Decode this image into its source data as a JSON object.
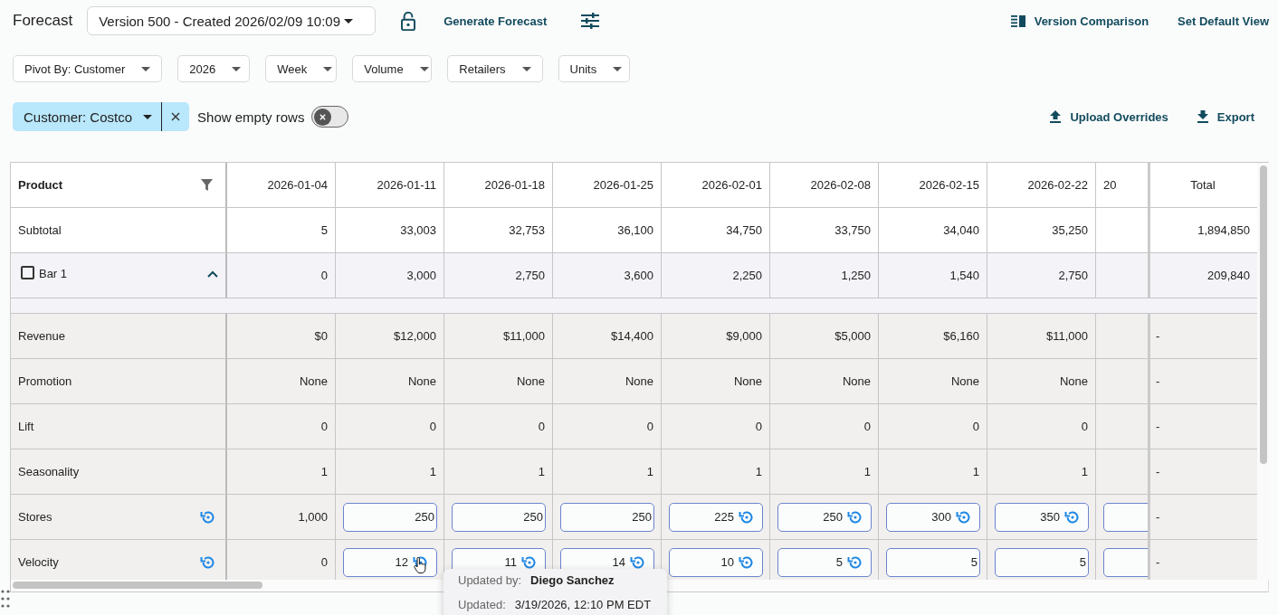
{
  "header": {
    "title": "Forecast",
    "version": "Version 500 - Created 2026/02/09 10:09",
    "generate": "Generate Forecast",
    "version_comparison": "Version Comparison",
    "set_default": "Set Default View"
  },
  "filters": [
    "Pivot By: Customer",
    "2026",
    "Week",
    "Volume",
    "Retailers",
    "Units"
  ],
  "chip": {
    "label": "Customer: Costco"
  },
  "toggle": {
    "label": "Show empty rows",
    "on": false
  },
  "actions": {
    "upload": "Upload Overrides",
    "export": "Export"
  },
  "table": {
    "first_column": "Product",
    "columns": [
      "2026-01-04",
      "2026-01-11",
      "2026-01-18",
      "2026-01-25",
      "2026-02-01",
      "2026-02-08",
      "2026-02-15",
      "2026-02-22",
      "20"
    ],
    "total_column": "Total",
    "rows": [
      {
        "kind": "subtotal",
        "label": "Subtotal",
        "cells": [
          "5",
          "33,003",
          "32,753",
          "36,100",
          "34,750",
          "33,750",
          "34,040",
          "35,250",
          null
        ],
        "total": "1,894,850"
      },
      {
        "kind": "group",
        "label": "Bar 1",
        "checked": false,
        "expanded": true,
        "cells": [
          "0",
          "3,000",
          "2,750",
          "3,600",
          "2,250",
          "1,250",
          "1,540",
          "2,750",
          null
        ],
        "total": "209,840"
      },
      {
        "kind": "metric",
        "label": "Revenue",
        "reset": false,
        "cells": [
          "$0",
          "$12,000",
          "$11,000",
          "$14,400",
          "$9,000",
          "$5,000",
          "$6,160",
          "$11,000",
          null
        ],
        "total": "-"
      },
      {
        "kind": "metric",
        "label": "Promotion",
        "reset": false,
        "cells": [
          "None",
          "None",
          "None",
          "None",
          "None",
          "None",
          "None",
          "None",
          null
        ],
        "total": "-"
      },
      {
        "kind": "metric",
        "label": "Lift",
        "reset": false,
        "cells": [
          "0",
          "0",
          "0",
          "0",
          "0",
          "0",
          "0",
          "0",
          null
        ],
        "total": "-"
      },
      {
        "kind": "metric",
        "label": "Seasonality",
        "reset": false,
        "cells": [
          "1",
          "1",
          "1",
          "1",
          "1",
          "1",
          "1",
          "1",
          null
        ],
        "total": "-"
      },
      {
        "kind": "metric",
        "label": "Stores",
        "reset": true,
        "cells": [
          "1,000",
          {
            "kind": "input",
            "value": "250",
            "reset": false
          },
          {
            "kind": "input",
            "value": "250",
            "reset": false
          },
          {
            "kind": "input",
            "value": "250",
            "reset": false
          },
          {
            "kind": "input",
            "value": "225",
            "reset": true
          },
          {
            "kind": "input",
            "value": "250",
            "reset": true
          },
          {
            "kind": "input",
            "value": "300",
            "reset": true
          },
          {
            "kind": "input",
            "value": "350",
            "reset": true
          },
          {
            "kind": "input",
            "reset": false
          }
        ],
        "total": "-"
      },
      {
        "kind": "metric",
        "label": "Velocity",
        "reset": true,
        "cells": [
          "0",
          {
            "kind": "input",
            "value": "12",
            "reset": true
          },
          {
            "kind": "input",
            "value": "11",
            "reset": true
          },
          {
            "kind": "input",
            "value": "14",
            "reset": true
          },
          {
            "kind": "input",
            "value": "10",
            "reset": true
          },
          {
            "kind": "input",
            "value": "5",
            "reset": true
          },
          {
            "kind": "input",
            "value": "5",
            "reset": false
          },
          {
            "kind": "input",
            "value": "5",
            "reset": false
          },
          {
            "kind": "input",
            "reset": false
          }
        ],
        "total": "-"
      }
    ]
  },
  "tooltip": [
    {
      "label": "Updated by:",
      "value": "Diego Sanchez"
    },
    {
      "label": "Updated:",
      "value": "3/19/2026, 12:10 PM EDT"
    }
  ]
}
